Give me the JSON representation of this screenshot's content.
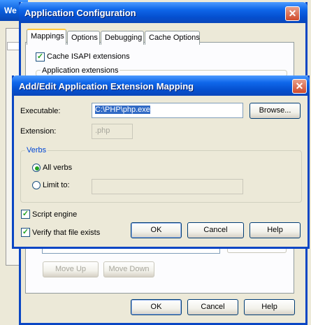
{
  "background_window": {
    "title": "We"
  },
  "main_window": {
    "title": "Application Configuration",
    "tabs": [
      {
        "label": "Mappings",
        "active": true
      },
      {
        "label": "Options"
      },
      {
        "label": "Debugging"
      },
      {
        "label": "Cache Options"
      }
    ],
    "cache_isapi_label": "Cache ISAPI extensions",
    "cache_isapi_checked": true,
    "app_extensions_label": "Application extensions",
    "move_up_label": "Move Up",
    "move_down_label": "Move Down",
    "ok_label": "OK",
    "cancel_label": "Cancel",
    "help_label": "Help"
  },
  "dialog": {
    "title": "Add/Edit Application Extension Mapping",
    "executable_label": "Executable:",
    "executable_value": "C:\\PHP\\php.exe",
    "browse_label": "Browse...",
    "extension_label": "Extension:",
    "extension_value": ".php",
    "verbs_label": "Verbs",
    "all_verbs_label": "All verbs",
    "all_verbs_selected": true,
    "limit_to_label": "Limit to:",
    "limit_to_value": "",
    "script_engine_label": "Script engine",
    "script_engine_checked": true,
    "verify_file_label": "Verify that file exists",
    "verify_file_checked": true,
    "ok_label": "OK",
    "cancel_label": "Cancel",
    "help_label": "Help"
  },
  "icons": {
    "close": "✕",
    "check": "✓"
  }
}
